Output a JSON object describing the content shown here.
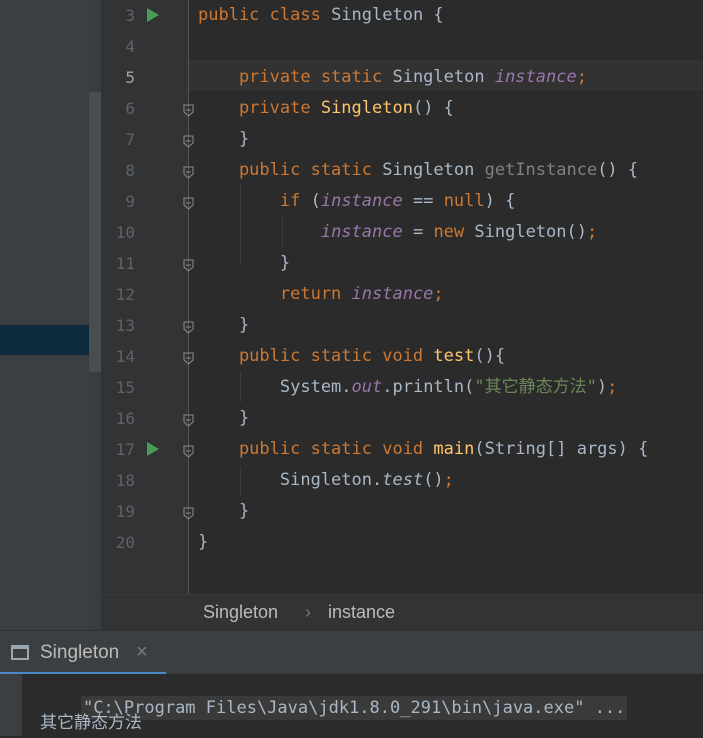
{
  "editor": {
    "lines": [
      {
        "num": "3",
        "run": true,
        "fold": false,
        "tokens": [
          {
            "t": "public class ",
            "c": "kw"
          },
          {
            "t": "Singleton {",
            "c": "plain"
          }
        ]
      },
      {
        "num": "4",
        "run": false,
        "fold": false,
        "tokens": []
      },
      {
        "num": "5",
        "run": false,
        "fold": false,
        "current": true,
        "tokens": [
          {
            "t": "    private static ",
            "c": "kw"
          },
          {
            "t": "Singleton ",
            "c": "plain"
          },
          {
            "t": "instance",
            "c": "fld"
          },
          {
            "t": ";",
            "c": "kw"
          }
        ]
      },
      {
        "num": "6",
        "run": false,
        "fold": true,
        "tokens": [
          {
            "t": "    private ",
            "c": "kw"
          },
          {
            "t": "Singleton",
            "c": "fn"
          },
          {
            "t": "() {",
            "c": "plain"
          }
        ]
      },
      {
        "num": "7",
        "run": false,
        "fold": true,
        "tokens": [
          {
            "t": "    }",
            "c": "plain"
          }
        ]
      },
      {
        "num": "8",
        "run": false,
        "fold": true,
        "tokens": [
          {
            "t": "    public static ",
            "c": "kw"
          },
          {
            "t": "Singleton ",
            "c": "plain"
          },
          {
            "t": "getInstance",
            "c": "gray"
          },
          {
            "t": "() {",
            "c": "plain"
          }
        ]
      },
      {
        "num": "9",
        "run": false,
        "fold": true,
        "tokens": [
          {
            "t": "        if ",
            "c": "kw"
          },
          {
            "t": "(",
            "c": "plain"
          },
          {
            "t": "instance",
            "c": "fld"
          },
          {
            "t": " == ",
            "c": "plain"
          },
          {
            "t": "null",
            "c": "kw"
          },
          {
            "t": ") {",
            "c": "plain"
          }
        ]
      },
      {
        "num": "10",
        "run": false,
        "fold": false,
        "tokens": [
          {
            "t": "            ",
            "c": "plain"
          },
          {
            "t": "instance",
            "c": "fld"
          },
          {
            "t": " = ",
            "c": "plain"
          },
          {
            "t": "new ",
            "c": "kw"
          },
          {
            "t": "Singleton()",
            "c": "plain"
          },
          {
            "t": ";",
            "c": "kw"
          }
        ]
      },
      {
        "num": "11",
        "run": false,
        "fold": true,
        "tokens": [
          {
            "t": "        }",
            "c": "plain"
          }
        ]
      },
      {
        "num": "12",
        "run": false,
        "fold": false,
        "tokens": [
          {
            "t": "        return ",
            "c": "kw"
          },
          {
            "t": "instance",
            "c": "fld"
          },
          {
            "t": ";",
            "c": "kw"
          }
        ]
      },
      {
        "num": "13",
        "run": false,
        "fold": true,
        "tokens": [
          {
            "t": "    }",
            "c": "plain"
          }
        ]
      },
      {
        "num": "14",
        "run": false,
        "fold": true,
        "tokens": [
          {
            "t": "    public static void ",
            "c": "kw"
          },
          {
            "t": "test",
            "c": "fn"
          },
          {
            "t": "(){",
            "c": "plain"
          }
        ]
      },
      {
        "num": "15",
        "run": false,
        "fold": false,
        "tokens": [
          {
            "t": "        System.",
            "c": "plain"
          },
          {
            "t": "out",
            "c": "fld"
          },
          {
            "t": ".println(",
            "c": "plain"
          },
          {
            "t": "\"其它静态方法\"",
            "c": "str"
          },
          {
            "t": ")",
            "c": "plain"
          },
          {
            "t": ";",
            "c": "kw"
          }
        ]
      },
      {
        "num": "16",
        "run": false,
        "fold": true,
        "tokens": [
          {
            "t": "    }",
            "c": "plain"
          }
        ]
      },
      {
        "num": "17",
        "run": true,
        "fold": true,
        "tokens": [
          {
            "t": "    public static void ",
            "c": "kw"
          },
          {
            "t": "main",
            "c": "fn"
          },
          {
            "t": "(String[] args) {",
            "c": "plain"
          }
        ]
      },
      {
        "num": "18",
        "run": false,
        "fold": false,
        "tokens": [
          {
            "t": "        Singleton.",
            "c": "plain"
          },
          {
            "t": "test",
            "c": "sfn"
          },
          {
            "t": "()",
            "c": "plain"
          },
          {
            "t": ";",
            "c": "kw"
          }
        ]
      },
      {
        "num": "19",
        "run": false,
        "fold": true,
        "tokens": [
          {
            "t": "    }",
            "c": "plain"
          }
        ]
      },
      {
        "num": "20",
        "run": false,
        "fold": false,
        "tokens": [
          {
            "t": "}",
            "c": "plain"
          }
        ]
      }
    ]
  },
  "breadcrumb": {
    "class_name": "Singleton",
    "separator": "›",
    "member_name": "instance"
  },
  "run_panel": {
    "tab_label": "Singleton",
    "close_symbol": "×",
    "console_command": "\"C:\\Program Files\\Java\\jdk1.8.0_291\\bin\\java.exe\" ...",
    "console_output": "其它静态方法"
  },
  "icons": {
    "run": "run-gutter-icon",
    "fold": "fold-marker-icon",
    "console": "console-icon",
    "close": "close-icon"
  }
}
